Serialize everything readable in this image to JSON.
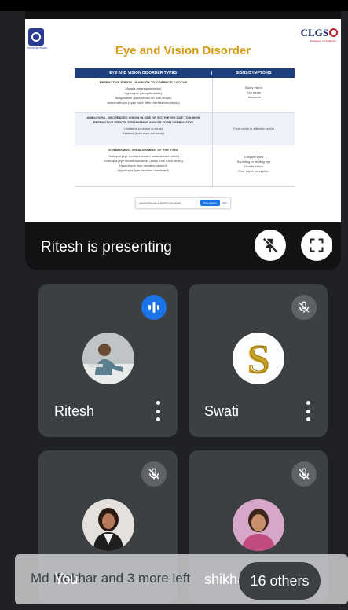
{
  "presentation": {
    "presenter_label": "Ritesh is presenting",
    "slide": {
      "title": "Eye and Vision Disorder",
      "logo_right": "CLGS",
      "logo_left_sub": "VISION NETWORK",
      "logo_right_sub": "Excellence In Healthcare",
      "table": {
        "headers": [
          "EYE AND VISION DISORDER TYPES",
          "SIGNS/SYMPTOMS"
        ],
        "rows": [
          {
            "type_title": "REFRACTIVE ERROR - INABILITY TO CORRECTLY FOCUS",
            "type_items": [
              "Myopia (nearsightedness)",
              "Hyperopia (farsightedness)",
              "Astigmatism (eyeball has an oval shape)",
              "Anisometropia (eyes have different refractive errors)"
            ],
            "symptoms": [
              "Blurry vision",
              "Eye strain",
              "Headache"
            ]
          },
          {
            "type_title": "AMBLYOPIA - DECREASED VISION IN ONE OR BOTH EYES DUE TO A HIGH REFRACTIVE ERROR, STRABISMUS AND/OR FORM DEPRIVATION",
            "type_items": [
              "Unilateral (one eye is weak)",
              "Bilateral (both eyes are weak)"
            ],
            "symptoms": [
              "Poor vision in affected eye(s)"
            ]
          },
          {
            "type_title": "STRABISMUS - MISALIGNMENT OF THE EYES",
            "type_items": [
              "Esotropia (eye deviates inward towards each other)",
              "Exotropia (eye deviates outward (away from each other))",
              "Hypertropia (eye deviates upward)",
              "Hypotropia (eye deviates downward)"
            ],
            "symptoms": [
              "Crossed eyes",
              "Squinting or shifting eye",
              "Double vision",
              "Poor depth perception"
            ]
          }
        ]
      },
      "share_bar": {
        "message": "meet.google.com is sharing your screen.",
        "stop_label": "Stop sharing",
        "hide_label": "Hide"
      }
    }
  },
  "participants": [
    {
      "name": "Ritesh",
      "status": "speaking"
    },
    {
      "name": "Swati",
      "status": "muted"
    },
    {
      "name": "You",
      "status": "muted"
    },
    {
      "name": "shikha",
      "status": "muted"
    }
  ],
  "toast": {
    "text": "Md Iftekhar and 3 more left"
  },
  "others": {
    "label": "16 others"
  },
  "icons": {
    "pin_off": "pin-off-icon",
    "fullscreen": "fullscreen-icon",
    "mic_off": "mic-off-icon",
    "speaking": "audio-level-icon",
    "more": "more-vert-icon"
  },
  "colors": {
    "background": "#202124",
    "tile": "#3c4043",
    "accent_blue": "#1a73e8",
    "slide_title": "#d49a12",
    "table_header": "#1d3f7c"
  }
}
